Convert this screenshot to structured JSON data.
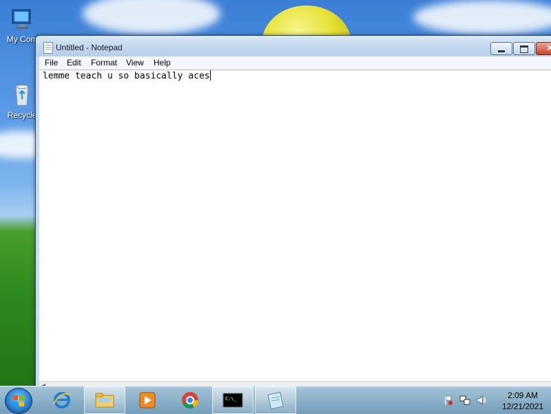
{
  "desktop": {
    "icons": [
      {
        "label": "My Com"
      },
      {
        "label": "Recycle"
      }
    ]
  },
  "notepad": {
    "title": "Untitled - Notepad",
    "menu": [
      "File",
      "Edit",
      "Format",
      "View",
      "Help"
    ],
    "content": "lemme teach u so basically aces"
  },
  "taskbar": {
    "apps": [
      "internet-explorer-icon",
      "windows-explorer-icon",
      "media-player-icon",
      "chrome-icon",
      "command-prompt-icon",
      "notepad-icon"
    ],
    "clock": {
      "time": "2:09 AM",
      "date": "12/21/2021"
    }
  }
}
